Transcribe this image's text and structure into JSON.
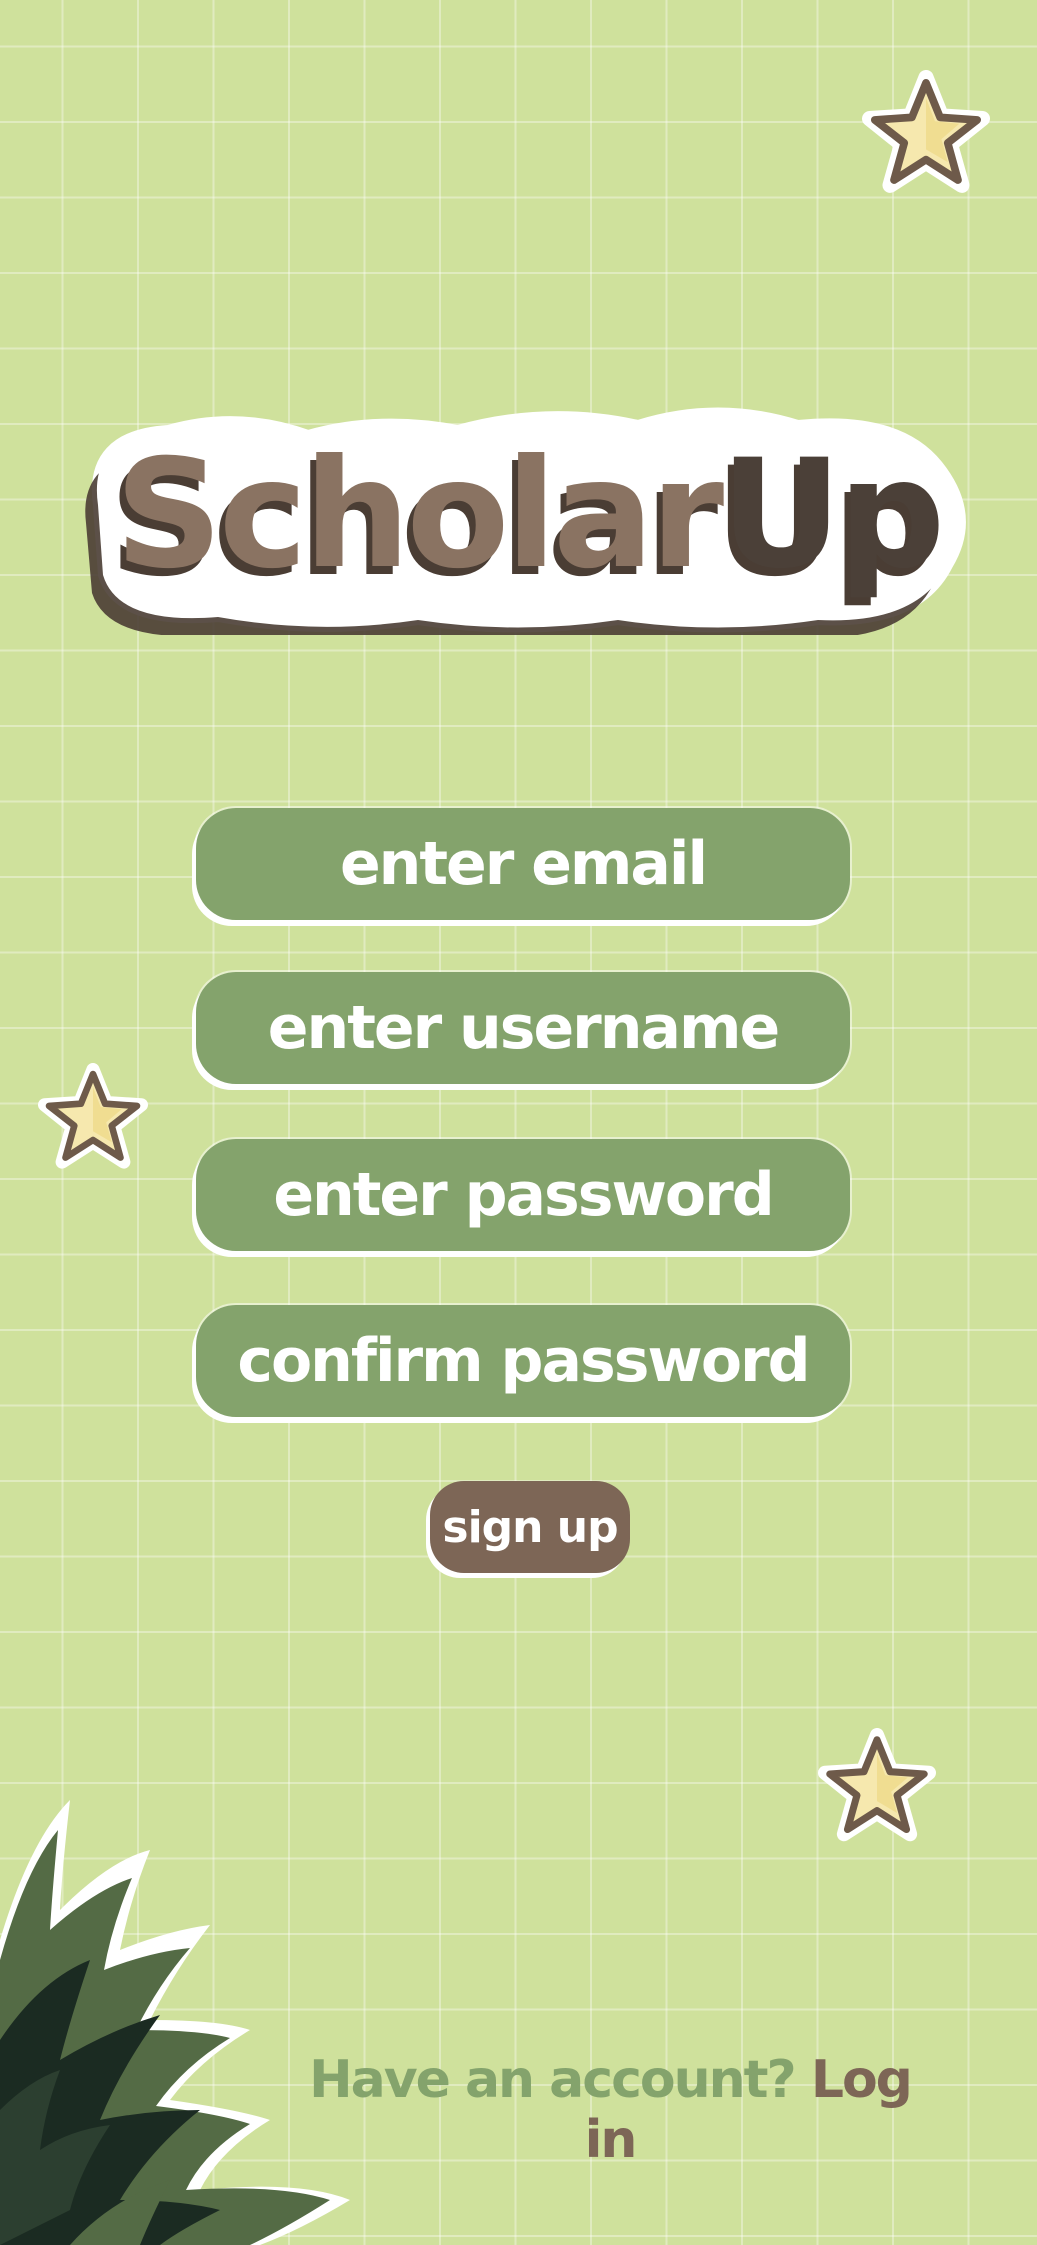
{
  "app": {
    "logo_text": "ScholarUp",
    "logo_part_a": "Scholar",
    "logo_part_b": "Up"
  },
  "form": {
    "email_placeholder": "enter email",
    "username_placeholder": "enter username",
    "password_placeholder": "enter password",
    "confirm_placeholder": "confirm password",
    "submit_label": "sign up"
  },
  "footer": {
    "prompt": "Have an account?",
    "login_label": "Log in"
  },
  "decorations": {
    "star_icon": "star-icon",
    "plant_icon": "leaf-plant-icon"
  },
  "colors": {
    "background": "#cfe19c",
    "input_fill": "#84a36c",
    "button_fill": "#7d6656",
    "logo_dark": "#4b4038",
    "star_fill": "#f6e8ae",
    "plant_dark": "#1b2b22",
    "plant_mid": "#546b45"
  }
}
